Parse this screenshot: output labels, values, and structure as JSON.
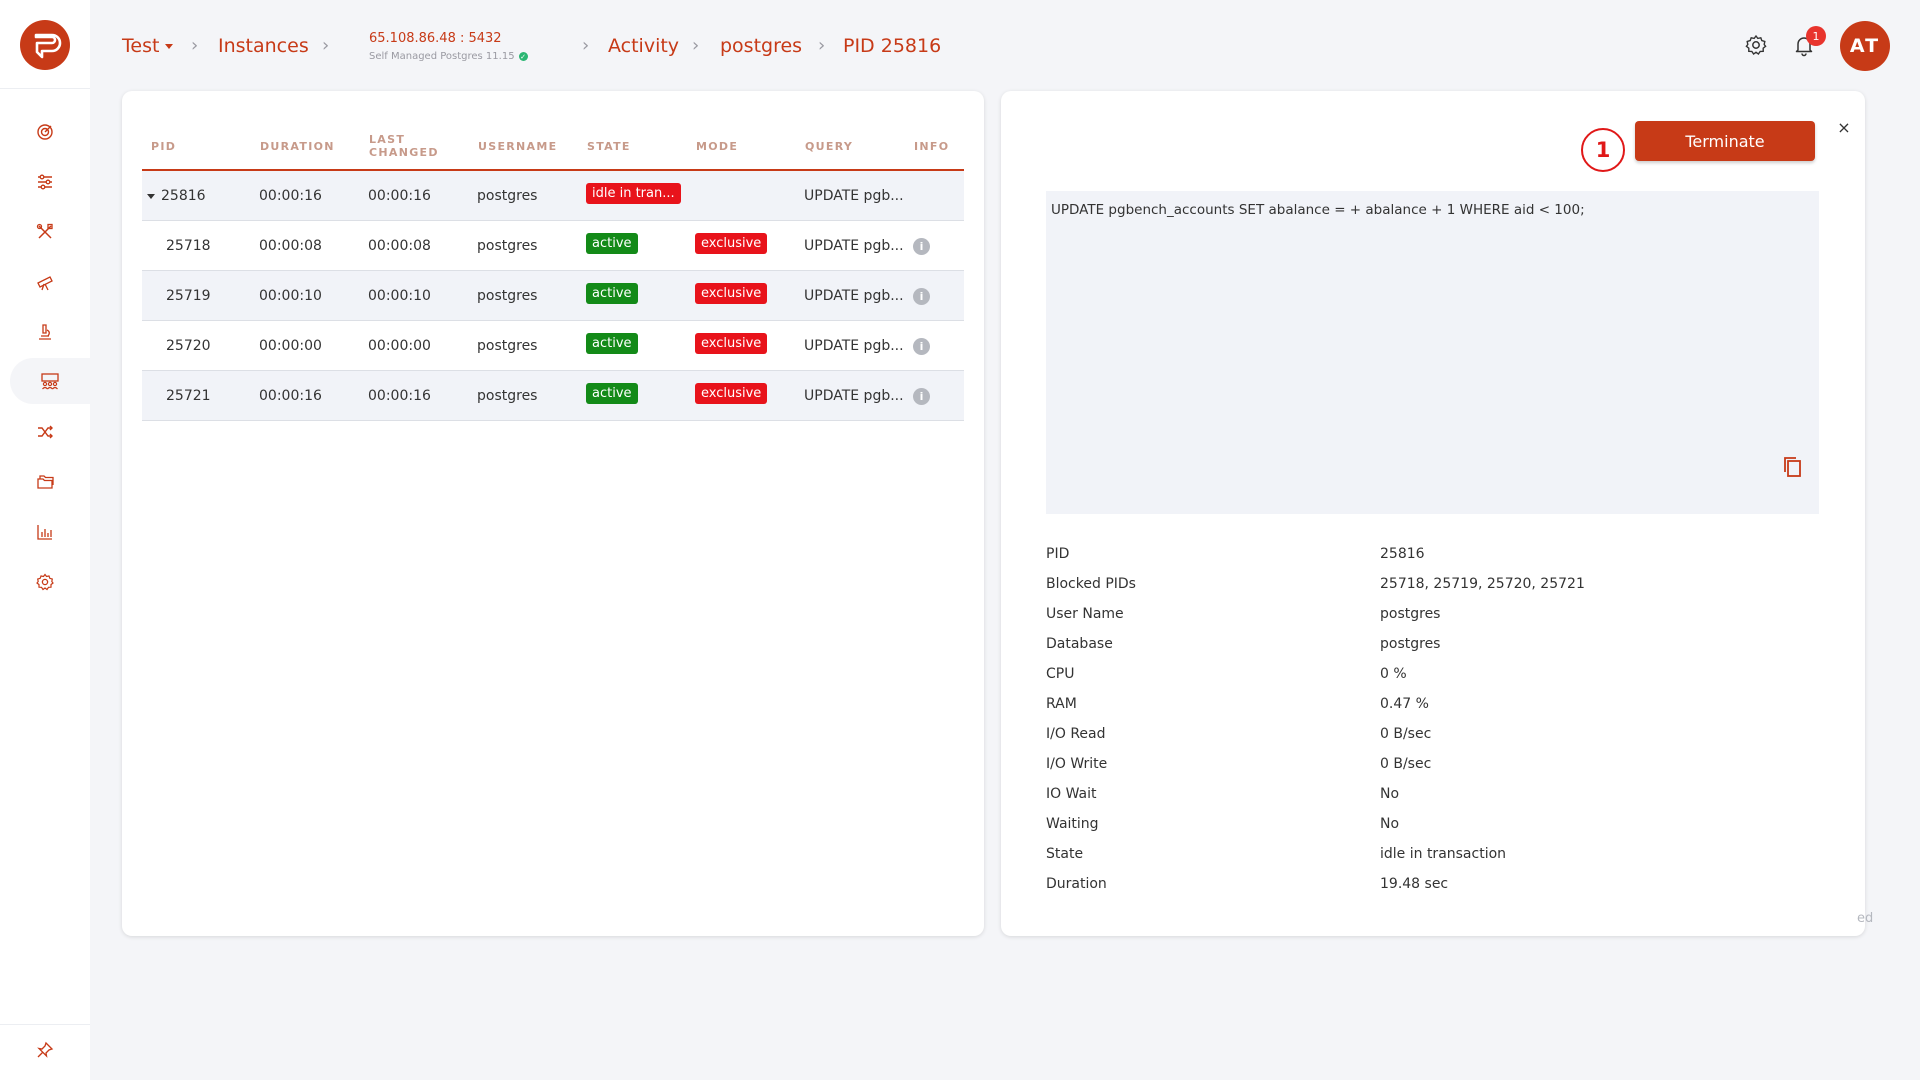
{
  "breadcrumb": {
    "project": "Test",
    "instances": "Instances",
    "instance_host": "65.108.86.48 : 5432",
    "instance_sub": "Self Managed Postgres 11.15",
    "activity": "Activity",
    "database": "postgres",
    "pid": "PID 25816"
  },
  "header": {
    "notification_count": "1",
    "avatar_initials": "AT"
  },
  "sidebar": {
    "items": [
      "dashboard-icon",
      "sliders-icon",
      "tools-icon",
      "telescope-icon",
      "microscope-icon",
      "activity-users-icon",
      "shuffle-icon",
      "folders-icon",
      "chart-icon",
      "settings-icon",
      "pin-icon"
    ]
  },
  "table": {
    "headers": {
      "pid": "PID",
      "duration": "DURATION",
      "last_changed_1": "LAST",
      "last_changed_2": "CHANGED",
      "username": "USERNAME",
      "state": "STATE",
      "mode": "MODE",
      "query": "QUERY",
      "info": "INFO"
    },
    "rows": [
      {
        "pid": "25816",
        "duration": "00:00:16",
        "last_changed": "00:00:16",
        "username": "postgres",
        "state": "idle in tran...",
        "mode": "",
        "query": "UPDATE pgb..."
      },
      {
        "pid": "25718",
        "duration": "00:00:08",
        "last_changed": "00:00:08",
        "username": "postgres",
        "state": "active",
        "mode": "exclusive",
        "query": "UPDATE pgb..."
      },
      {
        "pid": "25719",
        "duration": "00:00:10",
        "last_changed": "00:00:10",
        "username": "postgres",
        "state": "active",
        "mode": "exclusive",
        "query": "UPDATE pgb..."
      },
      {
        "pid": "25720",
        "duration": "00:00:00",
        "last_changed": "00:00:00",
        "username": "postgres",
        "state": "active",
        "mode": "exclusive",
        "query": "UPDATE pgb..."
      },
      {
        "pid": "25721",
        "duration": "00:00:16",
        "last_changed": "00:00:16",
        "username": "postgres",
        "state": "active",
        "mode": "exclusive",
        "query": "UPDATE pgb..."
      }
    ]
  },
  "details": {
    "step_number": "1",
    "terminate_label": "Terminate",
    "close_glyph": "×",
    "query_full": "UPDATE pgbench_accounts SET abalance = + abalance + 1 WHERE aid < 100;",
    "fields": [
      {
        "label": "PID",
        "value": "25816"
      },
      {
        "label": "Blocked PIDs",
        "value": "25718, 25719, 25720, 25721"
      },
      {
        "label": "User Name",
        "value": "postgres"
      },
      {
        "label": "Database",
        "value": "postgres"
      },
      {
        "label": "CPU",
        "value": "0 %"
      },
      {
        "label": "RAM",
        "value": "0.47 %"
      },
      {
        "label": "I/O Read",
        "value": "0 B/sec"
      },
      {
        "label": "I/O Write",
        "value": "0 B/sec"
      },
      {
        "label": "IO Wait",
        "value": "No"
      },
      {
        "label": "Waiting",
        "value": "No"
      },
      {
        "label": "State",
        "value": "idle in transaction"
      },
      {
        "label": "Duration",
        "value": "19.48 sec"
      }
    ],
    "ghost_text": "ed"
  },
  "colors": {
    "brand": "#c73a17",
    "active_green": "#138a18",
    "danger_red": "#e8131b"
  }
}
